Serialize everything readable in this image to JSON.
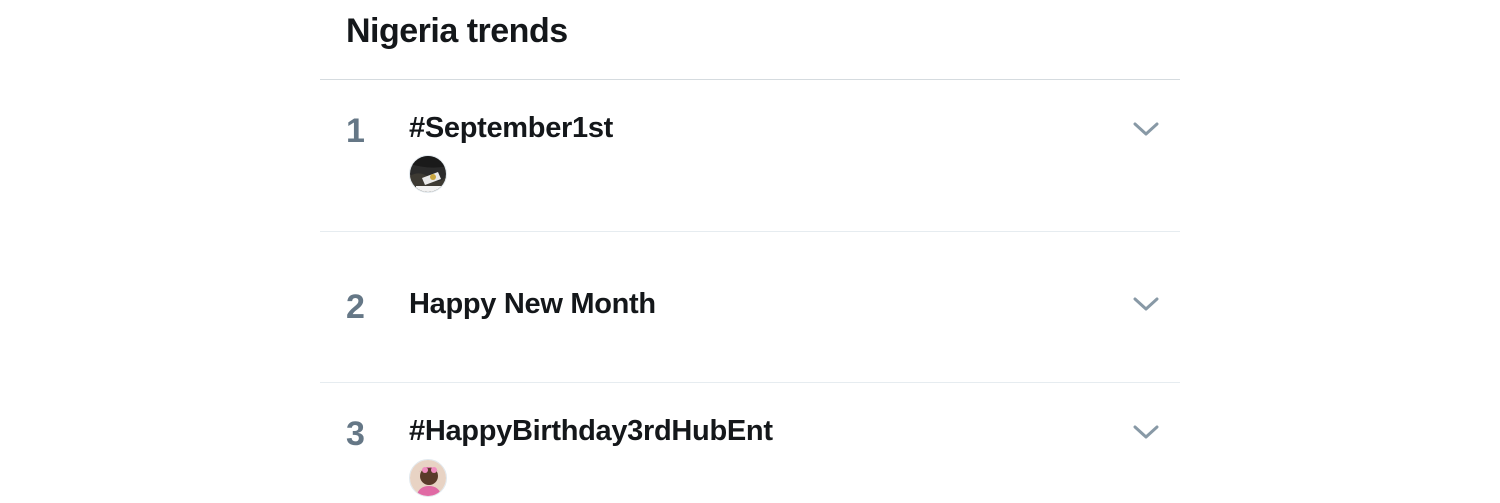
{
  "section": {
    "title": "Nigeria trends"
  },
  "trends": [
    {
      "rank": "1",
      "name": "#September1st",
      "has_avatar": true,
      "avatar_icon": "user-avatar"
    },
    {
      "rank": "2",
      "name": "Happy New Month",
      "has_avatar": false
    },
    {
      "rank": "3",
      "name": "#HappyBirthday3rdHubEnt",
      "has_avatar": true,
      "avatar_icon": "user-avatar"
    }
  ],
  "icons": {
    "expand": "chevron-down-icon"
  },
  "colors": {
    "text_primary": "#14171a",
    "text_secondary": "#657786",
    "chevron": "#8899a6",
    "divider": "#e6ecf0"
  }
}
